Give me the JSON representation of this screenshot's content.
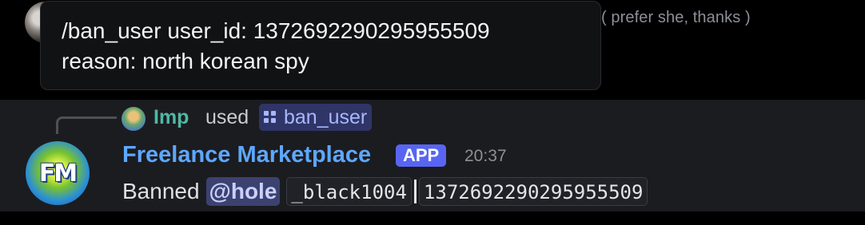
{
  "previous_message": {
    "text_fragment": "( prefer she, thanks )"
  },
  "tooltip": {
    "line1": "/ban_user user_id: 1372692290295955509",
    "line2": "reason: north korean spy"
  },
  "interaction": {
    "user_name": "Imp",
    "used_label": "used",
    "command_name": "ban_user"
  },
  "message": {
    "author": "Freelance Marketplace",
    "badge": "APP",
    "timestamp": "20:37",
    "avatar_text": "FM",
    "content_prefix": "Banned",
    "mention": "@hole",
    "code_username": "_black1004",
    "code_user_id": "1372692290295955509"
  },
  "colors": {
    "background": "#000000",
    "message_bg": "#1b1c20",
    "author_color": "#5ea7ff",
    "app_badge": "#5865f2",
    "imp_name": "#4fb8a4"
  }
}
